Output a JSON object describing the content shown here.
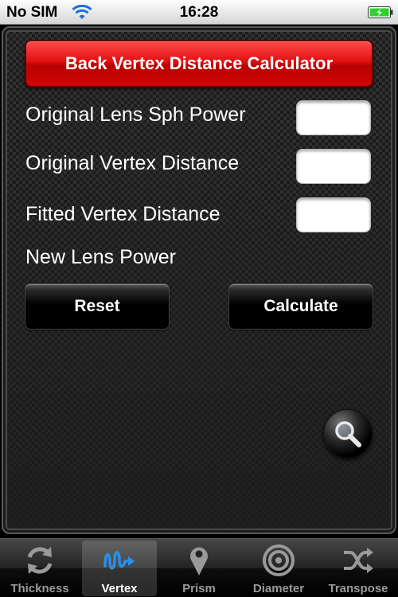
{
  "status_bar": {
    "carrier": "No SIM",
    "time": "16:28"
  },
  "calculator": {
    "title": "Back Vertex Distance Calculator",
    "fields": [
      {
        "label": "Original Lens Sph Power",
        "value": ""
      },
      {
        "label": "Original Vertex Distance",
        "value": ""
      },
      {
        "label": "Fitted Vertex Distance",
        "value": ""
      }
    ],
    "result_label": "New Lens Power",
    "reset_label": "Reset",
    "calculate_label": "Calculate"
  },
  "tab_bar": {
    "active_tab": "Vertex",
    "tabs": [
      {
        "label": "Thickness",
        "icon": "refresh-icon"
      },
      {
        "label": "Vertex",
        "icon": "wave-arrow-icon"
      },
      {
        "label": "Prism",
        "icon": "map-pin-icon"
      },
      {
        "label": "Diameter",
        "icon": "target-icon"
      },
      {
        "label": "Transpose",
        "icon": "shuffle-icon"
      }
    ]
  },
  "colors": {
    "title_red": "#e01010",
    "battery_green": "#2fd02f",
    "active_tab_icon": "#2a8fe8",
    "inactive_tab": "#9a9a9a"
  }
}
